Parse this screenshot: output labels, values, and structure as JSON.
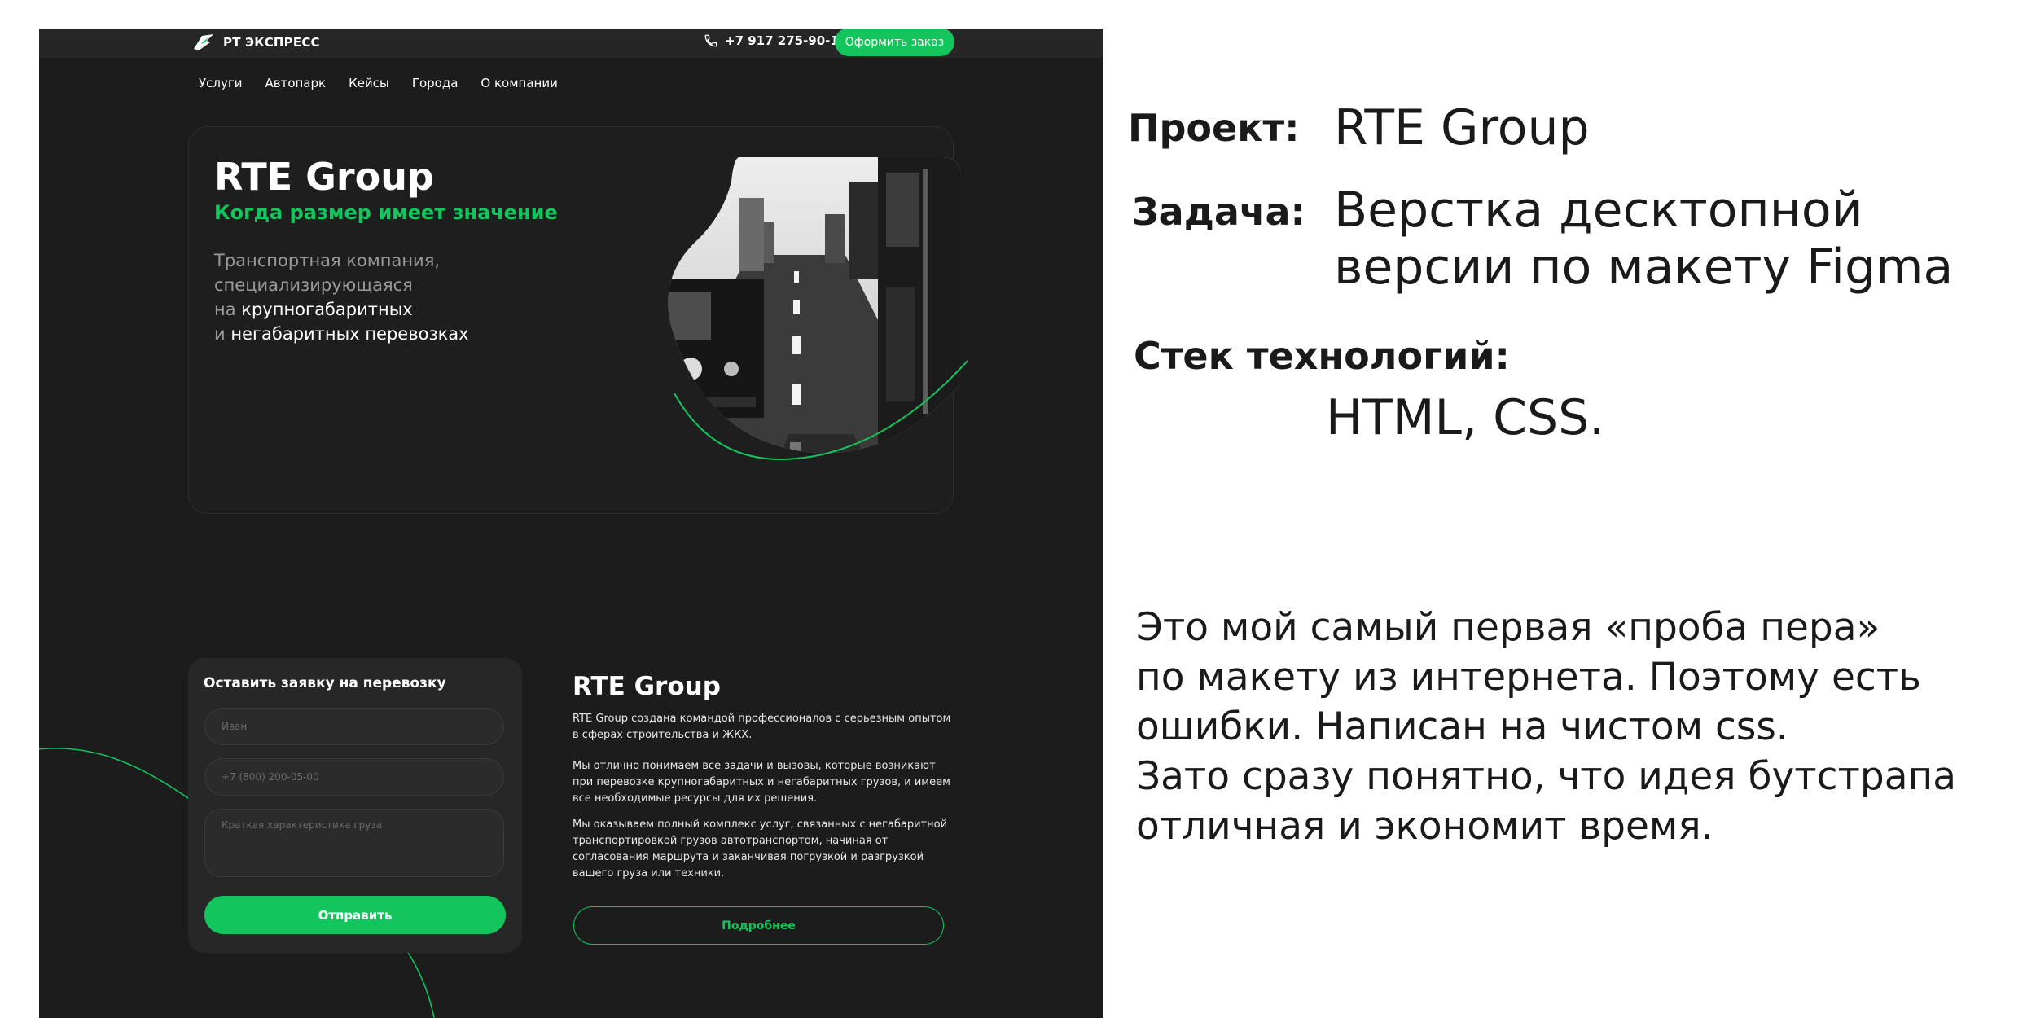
{
  "site": {
    "logo_text": "РТ ЭКСПРЕСС",
    "phone": "+7 917 275-90-13",
    "order_button": "Оформить заказ",
    "nav": [
      "Услуги",
      "Автопарк",
      "Кейсы",
      "Города",
      "О компании"
    ],
    "hero": {
      "title": "RTE Group",
      "subtitle": "Когда размер имеет значение",
      "text_1": "Транспортная компания,",
      "text_2": "специализирующаяся",
      "text_3_prefix": "на ",
      "text_3_highlight": "крупногабаритных",
      "text_4_prefix": "и ",
      "text_4_highlight": "негабаритных перевозках"
    },
    "form": {
      "title": "Оставить заявку на перевозку",
      "name_placeholder": "Иван",
      "phone_placeholder": "+7 (800) 200-05-00",
      "cargo_placeholder": "Краткая характеристика груза",
      "submit": "Отправить"
    },
    "about": {
      "title": "RTE Group",
      "p1": "RTE Group создана командой профессионалов с серьезным опытом в сферах строительства и ЖКХ.",
      "p2": "Мы отлично понимаем все задачи и вызовы, которые возникают при перевозке крупногабаритных и негабаритных грузов, и имеем все необходимые ресурсы для их решения.",
      "p3": "Мы оказываем полный комплекс услуг, связанных с негабаритной транспортировкой грузов автотранспортом, начиная от согласования маршрута и заканчивая погрузкой и разгрузкой вашего груза или техники.",
      "more": "Подробнее"
    },
    "accent_color": "#14c55d",
    "background_color": "#1c1c1c"
  },
  "description": {
    "project_label": "Проект:",
    "project_value": "RTE Group",
    "task_label": "Задача:",
    "task_value_1": "Верстка десктопной",
    "task_value_2": "версии по макету Figma",
    "stack_label": "Стек технологий:",
    "stack_value": "HTML, CSS.",
    "note_lines": [
      "Это мой самый первая «проба пера»",
      "по макету из интернета. Поэтому есть",
      "ошибки. Написан на чистом css.",
      "Зато сразу понятно, что идея бутстрапа",
      "отличная и экономит время."
    ]
  }
}
